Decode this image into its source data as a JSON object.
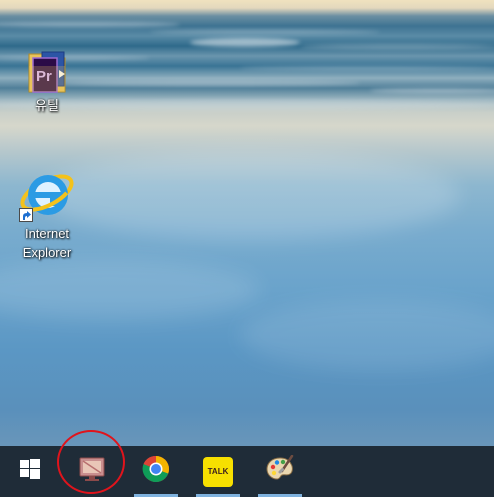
{
  "desktop": {
    "icons": [
      {
        "label": "유틸"
      },
      {
        "label": "Internet Explorer"
      }
    ]
  },
  "taskbar": {
    "buttons": [
      {
        "icon": "windows-start-icon",
        "active": false
      },
      {
        "icon": "screen-tool-icon",
        "active": false
      },
      {
        "icon": "chrome-icon",
        "active": true
      },
      {
        "icon": "kakaotalk-icon",
        "active": true,
        "badge_text": "TALK"
      },
      {
        "icon": "paint-palette-icon",
        "active": true
      }
    ],
    "colors": {
      "background": "#1f2c38",
      "active_indicator": "#7fb2de"
    }
  },
  "annotation": {
    "color": "#e0141c"
  }
}
